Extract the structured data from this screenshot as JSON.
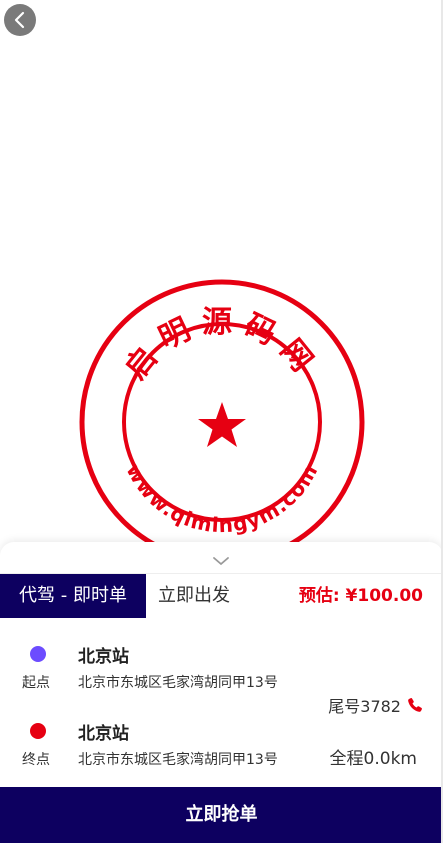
{
  "stamp": {
    "top_text": "启明源码网",
    "bottom_text": "www.qimingym.com"
  },
  "order": {
    "type_label": "代驾 - 即时单",
    "depart_label": "立即出发",
    "estimate_label": "预估: ¥100.00"
  },
  "route": {
    "start": {
      "label": "起点",
      "station": "北京站",
      "address": "北京市东城区毛家湾胡同甲13号",
      "dot_color": "#6c4cff"
    },
    "end": {
      "label": "终点",
      "station": "北京站",
      "address": "北京市东城区毛家湾胡同甲13号",
      "dot_color": "#e60012"
    }
  },
  "passenger": {
    "tail_number": "尾号3782"
  },
  "trip": {
    "distance": "全程0.0km"
  },
  "actions": {
    "grab_label": "立即抢单"
  },
  "colors": {
    "primary": "#0d0060",
    "accent": "#e60012"
  }
}
